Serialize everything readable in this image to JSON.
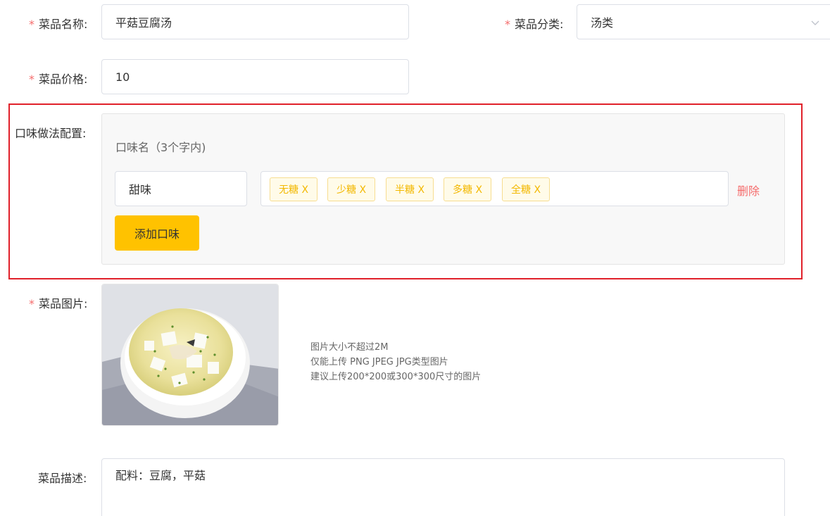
{
  "required_mark": "*",
  "form": {
    "name": {
      "label": "菜品名称:",
      "value": "平菇豆腐汤"
    },
    "category": {
      "label": "菜品分类:",
      "value": "汤类",
      "icon": "chevron-down-icon"
    },
    "price": {
      "label": "菜品价格:",
      "value": "10"
    },
    "flavor_config": {
      "label": "口味做法配置:",
      "hint": "口味名（3个字内)",
      "flavors": [
        {
          "name": "甜味",
          "tags": [
            "无糖 X",
            "少糖 X",
            "半糖 X",
            "多糖 X",
            "全糖 X"
          ],
          "delete_label": "删除"
        }
      ],
      "add_button": "添加口味"
    },
    "image": {
      "label": "菜品图片:",
      "hints": [
        "图片大小不超过2M",
        "仅能上传 PNG JPEG JPG类型图片",
        "建议上传200*200或300*300尺寸的图片"
      ]
    },
    "description": {
      "label": "菜品描述:",
      "value": "配料：豆腐，平菇"
    }
  },
  "colors": {
    "accent": "#ffc200",
    "required": "#f56c6c",
    "highlight_border": "#e0202a",
    "tag_text": "#f3b800"
  }
}
